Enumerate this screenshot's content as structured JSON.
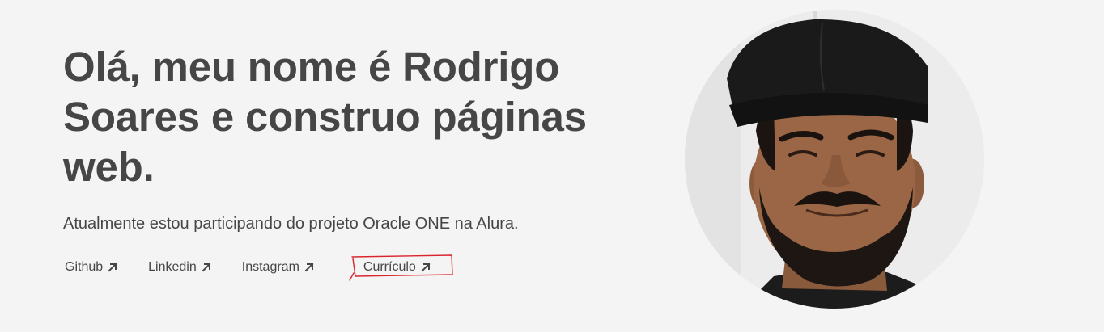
{
  "hero": {
    "title": "Olá, meu nome é Rodrigo Soares e construo páginas web.",
    "subtitle": "Atualmente estou participando do projeto Oracle ONE na Alura."
  },
  "links": [
    {
      "label": "Github",
      "icon": "arrow-up-right-icon"
    },
    {
      "label": "Linkedin",
      "icon": "arrow-up-right-icon"
    },
    {
      "label": "Instagram",
      "icon": "arrow-up-right-icon"
    },
    {
      "label": "Currículo",
      "icon": "arrow-up-right-icon"
    }
  ],
  "colors": {
    "background": "#f4f4f4",
    "text": "#464646",
    "annotation": "#d9262e"
  }
}
